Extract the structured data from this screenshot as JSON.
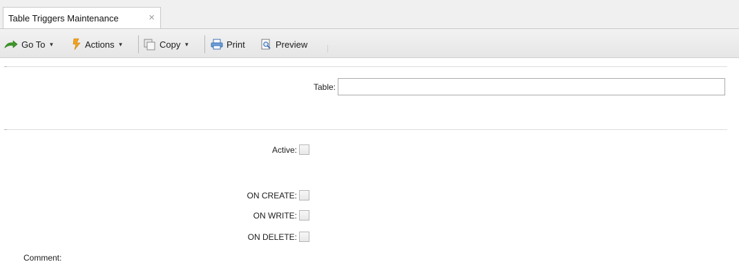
{
  "tab": {
    "title": "Table Triggers Maintenance",
    "close_glyph": "×"
  },
  "toolbar": {
    "goto_label": "Go To",
    "actions_label": "Actions",
    "copy_label": "Copy",
    "print_label": "Print",
    "preview_label": "Preview",
    "caret": "▼"
  },
  "form": {
    "table_label": "Table:",
    "table_value": "",
    "active_label": "Active:",
    "active_checked": false,
    "on_create_label": "ON CREATE:",
    "on_create_checked": false,
    "on_write_label": "ON WRITE:",
    "on_write_checked": false,
    "on_delete_label": "ON DELETE:",
    "on_delete_checked": false,
    "comment_label": "Comment:"
  },
  "colors": {
    "goto_green": "#3c9a2a",
    "actions_orange": "#f2a21b",
    "print_blue": "#3a6fb5"
  }
}
